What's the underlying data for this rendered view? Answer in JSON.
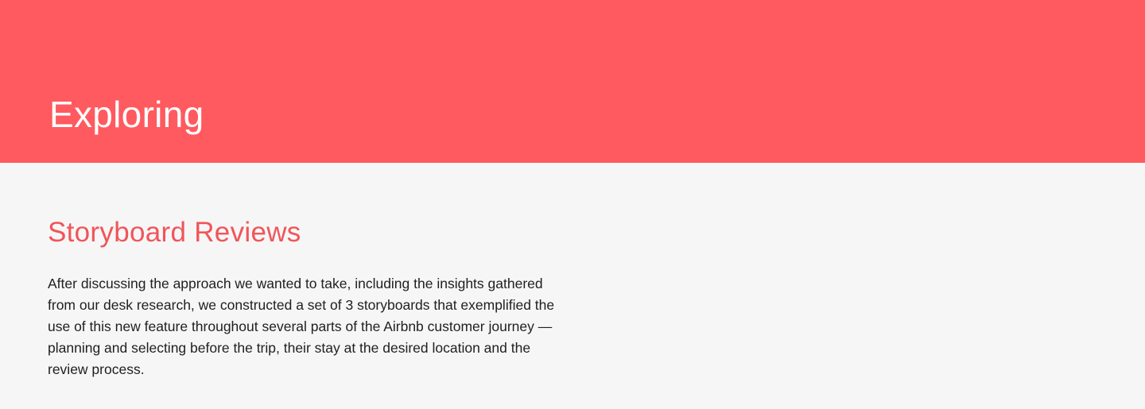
{
  "hero": {
    "title": "Exploring"
  },
  "section": {
    "title": "Storyboard Reviews",
    "body": "After discussing the approach we wanted to take, including the insights gathered from our desk research, we constructed a set of 3 storyboards that exemplified the use of this new feature throughout several parts of the Airbnb customer journey — planning and selecting before the trip, their stay at the desired location and the review process."
  },
  "colors": {
    "hero_background": "#ff5a5f",
    "page_background": "#f6f6f6",
    "accent_text": "#f0555a",
    "body_text": "#1f1f1f"
  }
}
